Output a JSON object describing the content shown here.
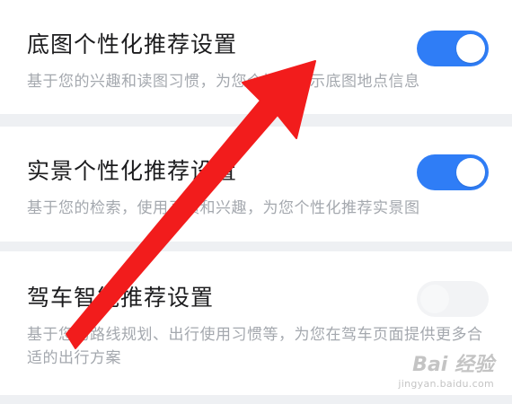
{
  "settings": [
    {
      "title": "底图个性化推荐设置",
      "description": "基于您的兴趣和读图习惯，为您个性化展示底图地点信息",
      "enabled": true
    },
    {
      "title": "实景个性化推荐设置",
      "description": "基于您的检索，使用习惯和兴趣，为您个性化推荐实景图",
      "enabled": true
    },
    {
      "title": "驾车智能推荐设置",
      "description": "基于您的路线规划、出行使用习惯等，为您在驾车页面提供更多合适的出行方案",
      "enabled": false
    }
  ],
  "colors": {
    "toggle_on": "#2f7df6",
    "toggle_off": "#f2f3f5",
    "annotation_arrow": "#f21c1c"
  },
  "watermark": {
    "logo_text": "Bai 经验",
    "url": "jingyan.baidu.com"
  }
}
